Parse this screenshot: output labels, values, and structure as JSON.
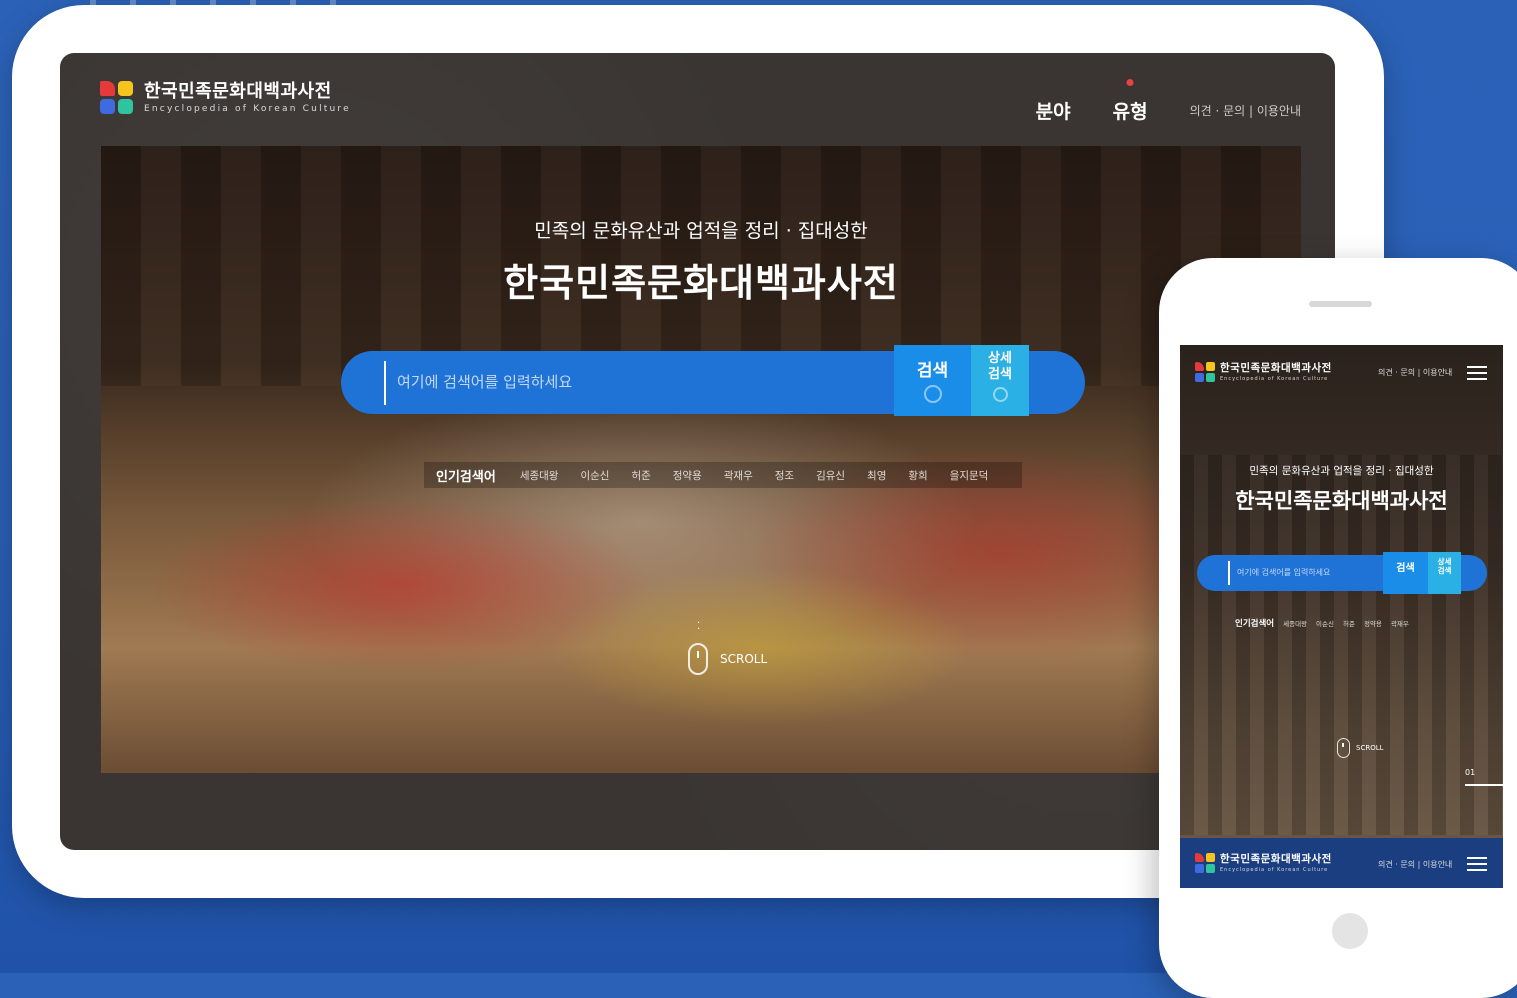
{
  "brand": {
    "name_ko": "한국민족문화대백과사전",
    "name_en": "Encyclopedia of Korean Culture"
  },
  "desktop": {
    "nav": {
      "items": [
        {
          "label": "분야",
          "active": false
        },
        {
          "label": "유형",
          "active": true
        }
      ],
      "util_links": "의견 · 문의  |  이용안내"
    },
    "hero": {
      "subtitle": "민족의 문화유산과 업적을 정리 · 집대성한",
      "title": "한국민족문화대백과사전"
    },
    "search": {
      "placeholder": "여기에 검색어를 입력하세요",
      "search_button": "검색",
      "advanced_button_line1": "상세",
      "advanced_button_line2": "검색"
    },
    "popular": {
      "title": "인기검색어",
      "keywords": [
        "세종대왕",
        "이순신",
        "허준",
        "정약용",
        "곽재우",
        "정조",
        "김유신",
        "최영",
        "황희",
        "을지문덕"
      ]
    },
    "scroll_label": "SCROLL"
  },
  "mobile": {
    "util_links": "의견 · 문의 | 이용안내",
    "hero": {
      "subtitle": "민족의 문화유산과 업적을 정리 · 집대성한",
      "title": "한국민족문화대백과사전"
    },
    "search": {
      "placeholder": "여기에 검색어를 입력하세요",
      "search_button": "검색",
      "advanced_button_line1": "상세",
      "advanced_button_line2": "검색"
    },
    "popular": {
      "title": "인기검색어",
      "keywords": [
        "세종대왕",
        "이순신",
        "허준",
        "정약용",
        "곽재우"
      ]
    },
    "scroll_label": "SCROLL",
    "slide_counter": "01"
  },
  "colors": {
    "background_blue": "#2b62b8",
    "search_blue": "#1f72d6",
    "search_button": "#1a8de8",
    "advanced_button": "#2ab0e4",
    "active_dot": "#e84242"
  },
  "icons": [
    "logo-mark",
    "search-icon",
    "zoom-in-icon",
    "mouse-scroll-icon",
    "hamburger-menu-icon"
  ]
}
